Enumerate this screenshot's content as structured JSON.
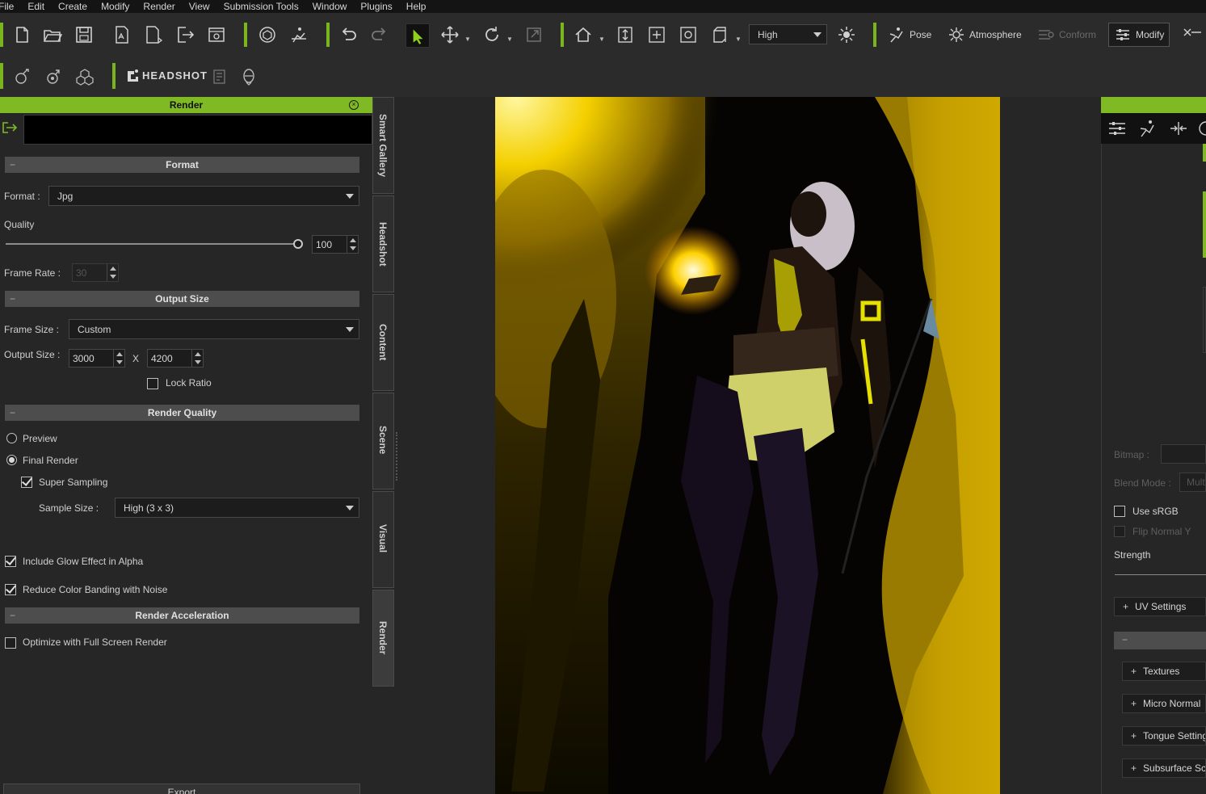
{
  "menu": [
    "File",
    "Edit",
    "Create",
    "Modify",
    "Render",
    "View",
    "Submission Tools",
    "Window",
    "Plugins",
    "Help"
  ],
  "toolbar": {
    "quality_select": "High",
    "pose_label": "Pose",
    "atmosphere_label": "Atmosphere",
    "conform_label": "Conform",
    "modify_label": "Modify",
    "headshot_label": "HEADSHOT"
  },
  "render_panel": {
    "title": "Render",
    "format": {
      "section_title": "Format",
      "format_label": "Format :",
      "format_value": "Jpg",
      "quality_label": "Quality",
      "quality_value": "100",
      "quality_fraction": 1.0,
      "frame_rate_label": "Frame Rate :",
      "frame_rate_value": "30"
    },
    "output_size": {
      "section_title": "Output Size",
      "frame_size_label": "Frame Size :",
      "frame_size_value": "Custom",
      "output_size_label": "Output Size :",
      "width": "3000",
      "x_label": "X",
      "height": "4200",
      "lock_ratio_label": "Lock Ratio",
      "lock_ratio_checked": false
    },
    "render_quality": {
      "section_title": "Render Quality",
      "preview_label": "Preview",
      "final_render_label": "Final Render",
      "selected": "Final Render",
      "super_sampling_label": "Super Sampling",
      "super_sampling_checked": true,
      "sample_size_label": "Sample Size :",
      "sample_size_value": "High (3 x 3)",
      "glow_alpha_label": "Include Glow Effect in Alpha",
      "glow_alpha_checked": true,
      "color_banding_label": "Reduce Color Banding with Noise",
      "color_banding_checked": true
    },
    "render_acceleration": {
      "section_title": "Render Acceleration",
      "optimize_label": "Optimize with Full Screen Render",
      "optimize_checked": false
    },
    "export_label": "Export"
  },
  "side_tabs": [
    "Smart Gallery",
    "Headshot",
    "Content",
    "Scene",
    "Visual",
    "Render"
  ],
  "active_side_tab": "Render",
  "right_panel": {
    "bitmap_label": "Bitmap :",
    "blend_mode_label": "Blend Mode :",
    "blend_mode_value": "Mult",
    "use_srgb_label": "Use sRGB",
    "flip_normal_label": "Flip Normal Y",
    "strength_label": "Strength",
    "uv_settings_label": "UV Settings",
    "textures_label": "Textures",
    "micro_normal_label": "Micro Normal",
    "tongue_settings_label": "Tongue Settings",
    "subsurface_label": "Subsurface Sc"
  },
  "colors": {
    "accent": "#7fba24",
    "panel_bg": "#262626",
    "section_header": "#4d4d4d"
  }
}
